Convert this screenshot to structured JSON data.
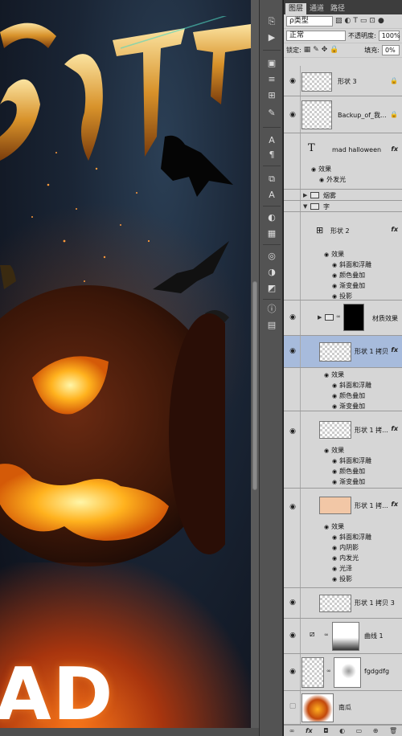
{
  "panel": {
    "tabs": [
      "图层",
      "通道",
      "路径"
    ],
    "filter_kind": "ρ类型",
    "blend_mode": "正常",
    "opacity_label": "不透明度:",
    "opacity_value": "100%",
    "lock_label": "锁定:",
    "fill_label": "填充:",
    "fill_value": "0%"
  },
  "layers": [
    {
      "name": "形状 3"
    },
    {
      "name": "Backup_of_我..."
    },
    {
      "name": "mad halloween",
      "effects_label": "效果",
      "effects": [
        "外发光"
      ]
    },
    {
      "name": "烟雾"
    },
    {
      "name": "字"
    },
    {
      "name": "形状 2",
      "effects_label": "效果",
      "effects": [
        "斜面和浮雕",
        "颜色叠加",
        "渐变叠加",
        "投影"
      ]
    },
    {
      "name": "材质效果"
    },
    {
      "name": "形状 1 拷贝",
      "effects_label": "效果",
      "effects": [
        "斜面和浮雕",
        "颜色叠加",
        "渐变叠加"
      ]
    },
    {
      "name": "形状 1 拷...",
      "effects_label": "效果",
      "effects": [
        "斜面和浮雕",
        "颜色叠加",
        "渐变叠加"
      ]
    },
    {
      "name": "形状 1 拷...",
      "effects_label": "效果",
      "effects": [
        "斜面和浮雕",
        "内阴影",
        "内发光",
        "光泽",
        "投影"
      ]
    },
    {
      "name": "形状 1 拷贝 3"
    },
    {
      "name": "曲线 1"
    },
    {
      "name": "fgdgdfg"
    },
    {
      "name": "南瓜"
    }
  ],
  "canvas": {
    "big_text": "AD"
  },
  "icons": {
    "eye": "eye-icon",
    "fx": "fx-badge",
    "lock": "lock-icon",
    "folder": "folder-icon",
    "link": "link-chain-icon",
    "type": "type-layer-icon"
  },
  "colors": {
    "selected_row": "#a7bbdc",
    "panel_bg": "#d6d6d6"
  }
}
